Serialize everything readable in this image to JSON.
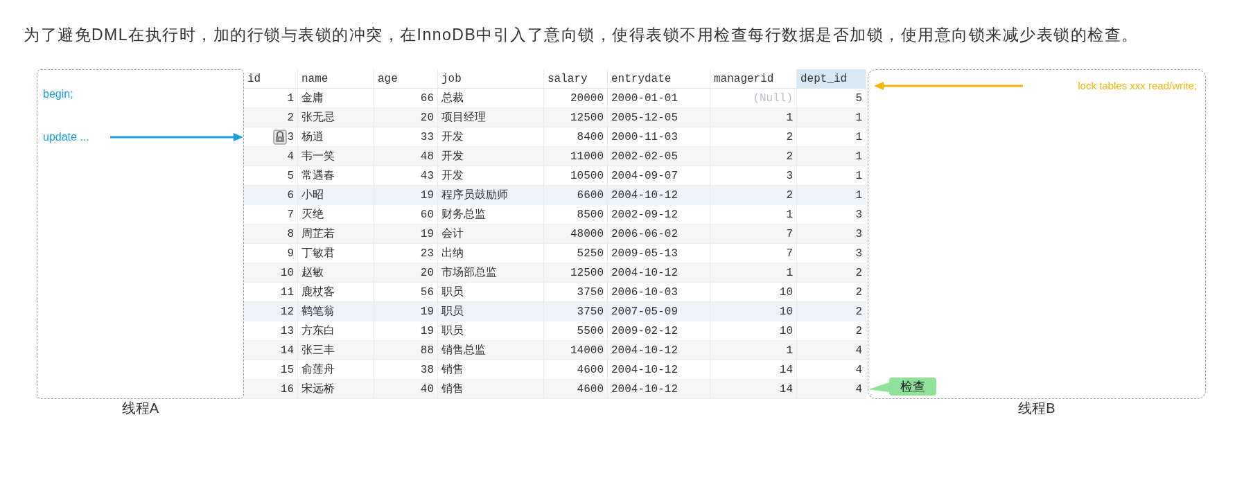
{
  "paragraph": "为了避免DML在执行时，加的行锁与表锁的冲突，在InnoDB中引入了意向锁，使得表锁不用检查每行数据是否加锁，使用意向锁来减少表锁的检查。",
  "thread_a": {
    "label": "线程A",
    "lines": [
      "begin;",
      "update ..."
    ]
  },
  "table": {
    "columns": [
      {
        "label": "id",
        "selected": false
      },
      {
        "label": "name",
        "selected": false
      },
      {
        "label": "age",
        "selected": false
      },
      {
        "label": "job",
        "selected": false
      },
      {
        "label": "salary",
        "selected": false
      },
      {
        "label": "entrydate",
        "selected": false
      },
      {
        "label": "managerid",
        "selected": false
      },
      {
        "label": "dept_id",
        "selected": true
      }
    ],
    "rows": [
      {
        "locked": false,
        "highlighted": false,
        "cells": [
          "1",
          "金庸",
          "66",
          "总裁",
          "20000",
          "2000-01-01",
          {
            "text": "(Null)",
            "kind": "null"
          },
          "5"
        ]
      },
      {
        "locked": false,
        "highlighted": false,
        "cells": [
          "2",
          "张无忌",
          "20",
          "项目经理",
          "12500",
          "2005-12-05",
          "1",
          "1"
        ]
      },
      {
        "locked": true,
        "highlighted": false,
        "cells": [
          "3",
          "杨逍",
          "33",
          "开发",
          "8400",
          "2000-11-03",
          "2",
          "1"
        ]
      },
      {
        "locked": false,
        "highlighted": false,
        "cells": [
          "4",
          "韦一笑",
          "48",
          "开发",
          "11000",
          "2002-02-05",
          "2",
          "1"
        ]
      },
      {
        "locked": false,
        "highlighted": false,
        "cells": [
          "5",
          "常遇春",
          "43",
          "开发",
          "10500",
          "2004-09-07",
          "3",
          "1"
        ]
      },
      {
        "locked": false,
        "highlighted": true,
        "cells": [
          "6",
          "小昭",
          "19",
          "程序员鼓励师",
          "6600",
          "2004-10-12",
          "2",
          "1"
        ]
      },
      {
        "locked": false,
        "highlighted": false,
        "cells": [
          "7",
          "灭绝",
          "60",
          "财务总监",
          "8500",
          "2002-09-12",
          "1",
          "3"
        ]
      },
      {
        "locked": false,
        "highlighted": false,
        "cells": [
          "8",
          "周芷若",
          "19",
          "会计",
          "48000",
          "2006-06-02",
          "7",
          "3"
        ]
      },
      {
        "locked": false,
        "highlighted": false,
        "cells": [
          "9",
          "丁敏君",
          "23",
          "出纳",
          "5250",
          "2009-05-13",
          "7",
          "3"
        ]
      },
      {
        "locked": false,
        "highlighted": false,
        "cells": [
          "10",
          "赵敏",
          "20",
          "市场部总监",
          "12500",
          "2004-10-12",
          "1",
          "2"
        ]
      },
      {
        "locked": false,
        "highlighted": false,
        "cells": [
          "11",
          "鹿杖客",
          "56",
          "职员",
          "3750",
          "2006-10-03",
          "10",
          "2"
        ]
      },
      {
        "locked": false,
        "highlighted": true,
        "cells": [
          "12",
          "鹤笔翁",
          "19",
          "职员",
          "3750",
          "2007-05-09",
          "10",
          "2"
        ]
      },
      {
        "locked": false,
        "highlighted": false,
        "cells": [
          "13",
          "方东白",
          "19",
          "职员",
          "5500",
          "2009-02-12",
          "10",
          "2"
        ]
      },
      {
        "locked": false,
        "highlighted": false,
        "cells": [
          "14",
          "张三丰",
          "88",
          "销售总监",
          "14000",
          "2004-10-12",
          "1",
          "4"
        ]
      },
      {
        "locked": false,
        "highlighted": false,
        "cells": [
          "15",
          "俞莲舟",
          "38",
          "销售",
          "4600",
          "2004-10-12",
          "14",
          "4"
        ]
      },
      {
        "locked": false,
        "highlighted": false,
        "cells": [
          "16",
          "宋远桥",
          "40",
          "销售",
          "4600",
          "2004-10-12",
          "14",
          "4"
        ]
      }
    ]
  },
  "thread_b": {
    "label": "线程B",
    "command": "lock tables xxx read/write;",
    "callout": "检查"
  }
}
